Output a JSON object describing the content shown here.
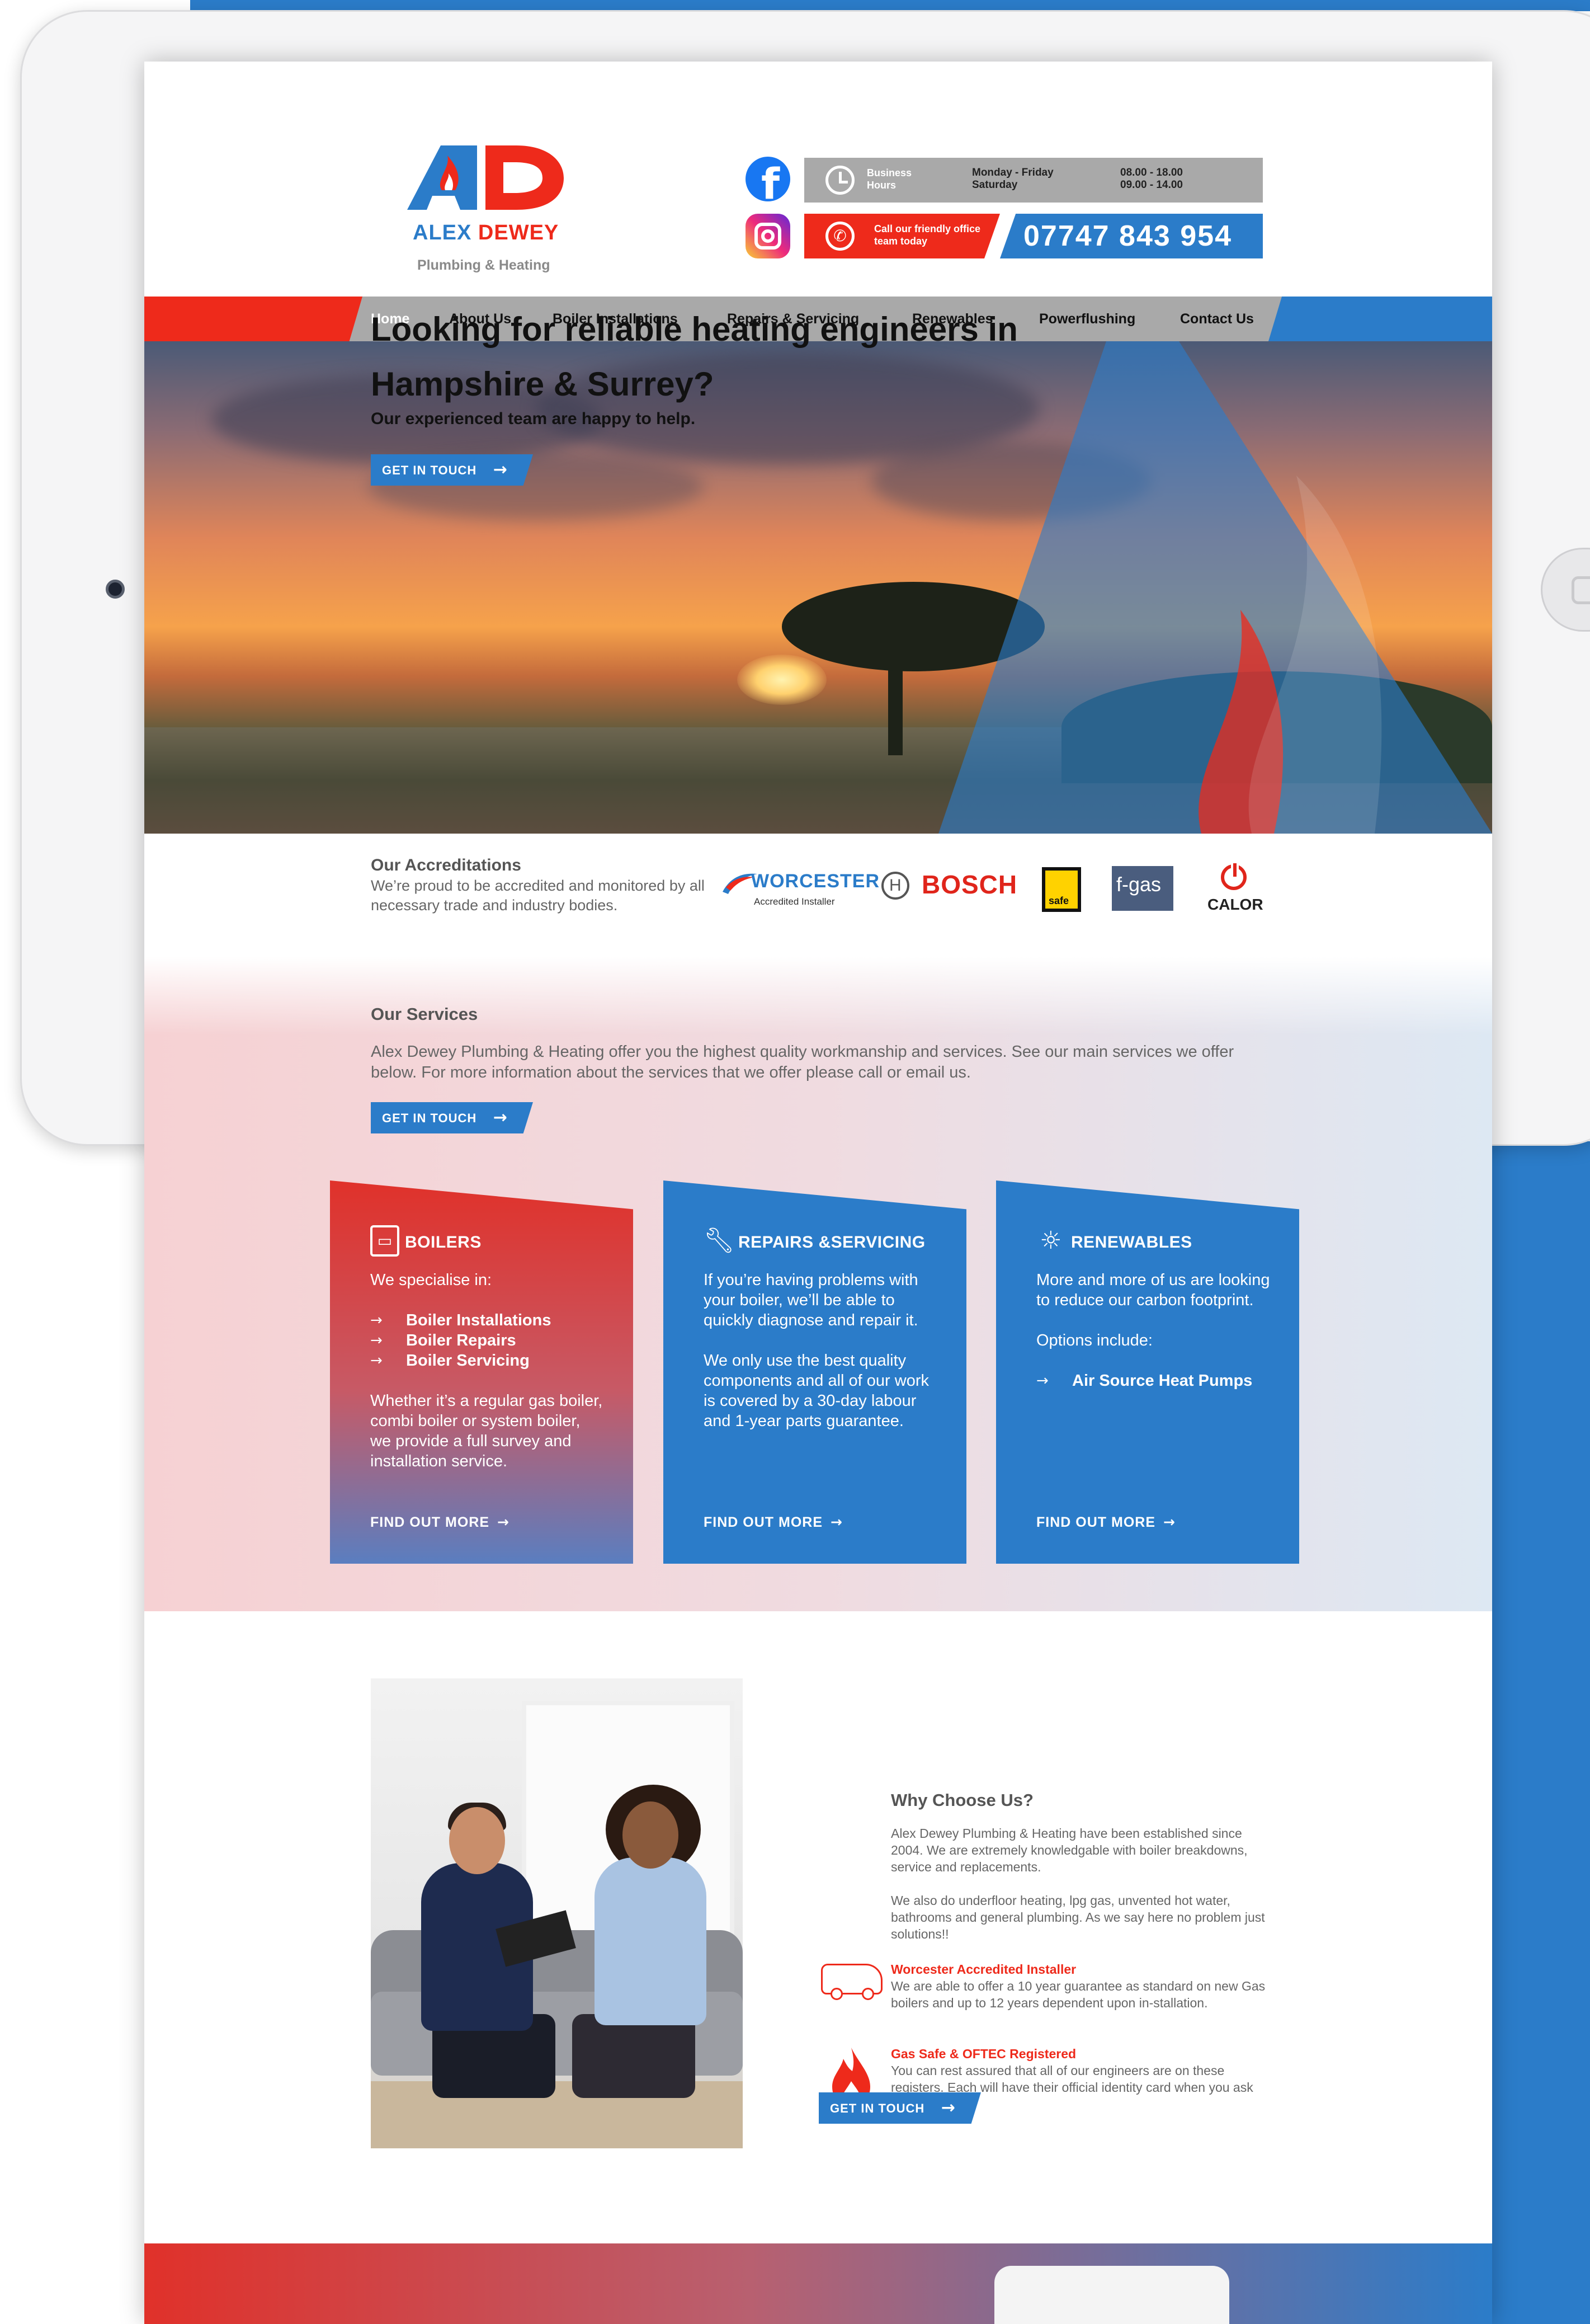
{
  "colors": {
    "blue": "#2b7cc9",
    "red": "#ee2a1b",
    "grey": "#a9a9a9"
  },
  "logo": {
    "letters": "AD",
    "brand_first": "ALEX",
    "brand_second": "DEWEY",
    "tagline": "Plumbing & Heating"
  },
  "header": {
    "social_icons": [
      "facebook-icon",
      "instagram-icon"
    ],
    "hours_label": "Business Hours",
    "hours_days": [
      "Monday - Friday",
      "Saturday"
    ],
    "hours_times": [
      "08.00 - 18.00",
      "09.00 - 14.00"
    ],
    "call_label": "Call our friendly office team today",
    "phone": "07747 843 954"
  },
  "nav": {
    "items": [
      "Home",
      "About Us",
      "Boiler Installations",
      "Repairs  & Servicing",
      "Renewables",
      "Powerflushing",
      "Contact Us"
    ],
    "active": "Home"
  },
  "hero": {
    "title": "Looking for reliable heating engineers in Hampshire & Surrey?",
    "subtitle": "Our experienced team are happy to help.",
    "cta": "GET IN TOUCH"
  },
  "accreditations": {
    "title": "Our Accreditations",
    "text": "We’re proud to be accredited and monitored by all necessary trade and industry bodies.",
    "logos": {
      "worcester": "WORCESTER",
      "worcester_sub": "Accredited Installer",
      "bosch": "BOSCH",
      "gas_safe": "safe",
      "fgas": "f-gas",
      "calor": "CALOR"
    }
  },
  "services": {
    "title": "Our Services",
    "text": "Alex Dewey Plumbing & Heating offer you the highest quality workmanship and services. See our main services we offer below. For more information about the services that we offer please call or email us.",
    "cta": "GET IN TOUCH",
    "cards": [
      {
        "title": "BOILERS",
        "icon": "boiler-icon",
        "intro": "We specialise in:",
        "list": [
          "Boiler Installations",
          "Boiler Repairs",
          "Boiler Servicing"
        ],
        "outro": "Whether it’s a regular gas boiler, combi boiler or system boiler, we provide a full survey and installation service.",
        "more": "FIND OUT MORE"
      },
      {
        "title": "REPAIRS &SERVICING",
        "icon": "wrench-icon",
        "intro": "If you’re having problems with your boiler, we’ll be able to quickly diagnose and repair it.",
        "outro": "We only use the best quality components and all of our work is covered by a 30-day labour and 1-year parts guarantee.",
        "more": "FIND OUT MORE"
      },
      {
        "title": "RENEWABLES",
        "icon": "sun-plug-icon",
        "intro": "More and more of us are looking to reduce our carbon footprint.",
        "options": "Options include:",
        "list": [
          "Air Source Heat Pumps"
        ],
        "more": "FIND OUT MORE"
      }
    ]
  },
  "why": {
    "title": "Why Choose Us?",
    "p1": "Alex Dewey Plumbing & Heating have been established since 2004. We are extremely knowledgable with boiler breakdowns, service and replacements.",
    "p2": "We also do underfloor heating, lpg gas, unvented hot water, bathrooms and general plumbing. As we say here no problem just solutions!!",
    "feature1_title": "Worcester Accredited Installer",
    "feature1_text": "We are able to offer a 10 year guarantee as standard on new Gas boilers and up to 12 years dependent upon in-stallation.",
    "feature2_title": "Gas Safe & OFTEC Registered",
    "feature2_text": "You can rest assured that all of our engineers are on these registers. Each will have their official identity card when you ask to see it.",
    "cta": "GET IN TOUCH"
  }
}
